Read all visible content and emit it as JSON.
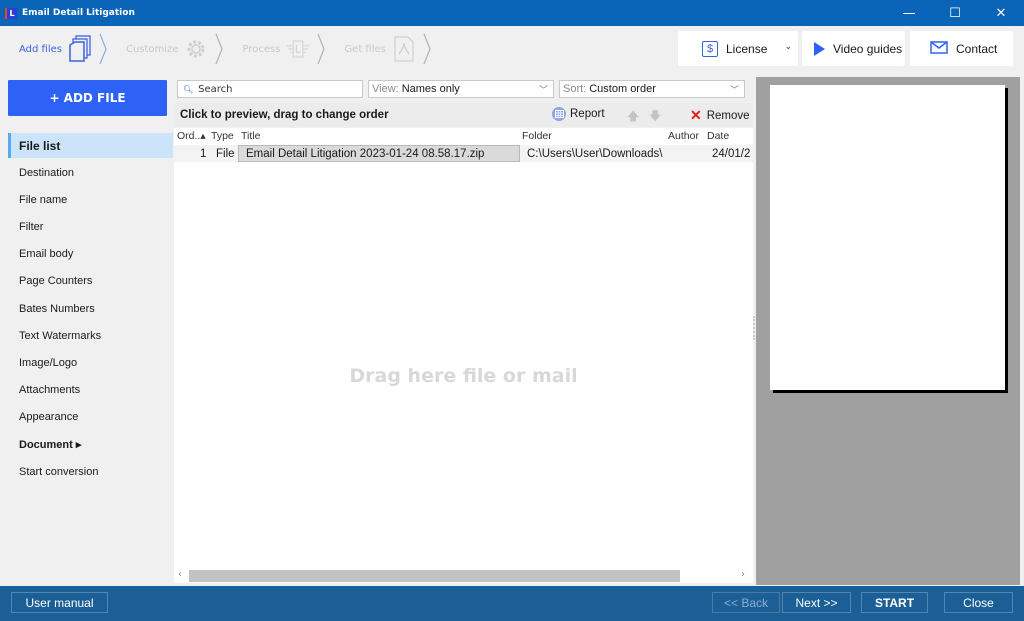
{
  "window": {
    "title": "Email Detail Litigation",
    "app_icon_letter": "L",
    "controls": {
      "minimize": "—",
      "maximize": "☐",
      "close": "✕"
    }
  },
  "wizard": {
    "steps": [
      {
        "label": "Add files",
        "icon": "files-icon",
        "active": true
      },
      {
        "label": "Customize",
        "icon": "gear-icon",
        "active": false
      },
      {
        "label": "Process",
        "icon": "process-icon",
        "active": false
      },
      {
        "label": "Get files",
        "icon": "pdf-icon",
        "active": false
      }
    ]
  },
  "top_buttons": {
    "license": "License",
    "video_guides": "Video guides",
    "contact": "Contact"
  },
  "accent_color": "#2e62f7",
  "add_file_label": "+ ADD FILE",
  "sidebar": {
    "items": [
      {
        "label": "File list",
        "active": true
      },
      {
        "label": "Destination"
      },
      {
        "label": "File name"
      },
      {
        "label": "Filter"
      },
      {
        "label": "Email body"
      },
      {
        "label": "Page Counters"
      },
      {
        "label": "Bates Numbers"
      },
      {
        "label": "Text Watermarks"
      },
      {
        "label": "Image/Logo"
      },
      {
        "label": "Attachments"
      },
      {
        "label": "Appearance"
      },
      {
        "label": "Document ▸",
        "bold": true
      },
      {
        "label": "Start conversion"
      }
    ]
  },
  "toolbar": {
    "search_placeholder": "Search",
    "view_prefix": "View:",
    "view_value": "Names only",
    "sort_prefix": "Sort:",
    "sort_value": "Custom order"
  },
  "list": {
    "hint": "Click to preview, drag to change order",
    "report_label": "Report",
    "remove_label": "Remove",
    "columns": [
      "Ord..▴",
      "Type",
      "Title",
      "Folder",
      "Author",
      "Date"
    ],
    "rows": [
      {
        "order": "1",
        "type": "File",
        "title": "Email Detail Litigation 2023-01-24 08.58.17.zip",
        "folder": "C:\\Users\\User\\Downloads\\",
        "author": "",
        "date": "24/01/2"
      }
    ],
    "drop_hint": "Drag here file or mail"
  },
  "footer": {
    "user_manual": "User manual",
    "back": "<< Back",
    "next": "Next >>",
    "start": "START",
    "close": "Close"
  }
}
